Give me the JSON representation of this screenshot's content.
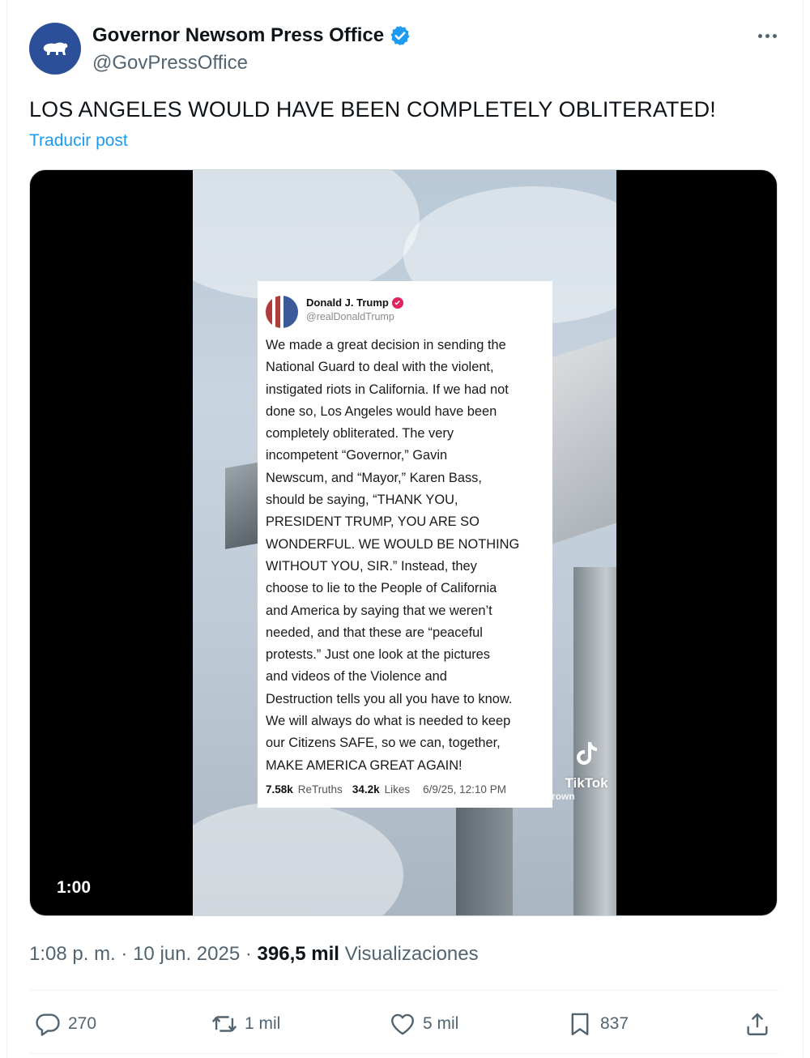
{
  "author": {
    "name": "Governor Newsom Press Office",
    "handle": "@GovPressOffice",
    "verified": true,
    "verified_color": "#1d9bf0",
    "avatar_color": "#2c4f9a"
  },
  "post": {
    "text": "LOS ANGELES WOULD HAVE BEEN COMPLETELY OBLITERATED!",
    "translate_label": "Traducir post"
  },
  "media": {
    "duration": "1:00",
    "embedded_post": {
      "name": "Donald J. Trump",
      "handle": "@realDonaldTrump",
      "body": "We made a great decision in sending the\nNational Guard to deal with the violent,\ninstigated riots in California. If we had not\ndone so, Los Angeles would have been\ncompletely obliterated. The very\nincompetent “Governor,”  Gavin\nNewscum, and “Mayor,” Karen Bass,\nshould be saying, “THANK YOU,\nPRESIDENT TRUMP, YOU ARE SO\nWONDERFUL. WE WOULD BE NOTHING\nWITHOUT YOU, SIR.” Instead, they\nchoose to lie to the People of California\nand America by saying that we weren’t\nneeded, and that these are “peaceful\nprotests.” Just one look at the pictures\nand videos of the Violence and\nDestruction tells you all you have to know.\nWe will always do what is needed to keep\nour Citizens SAFE, so we can, together,\nMAKE AMERICA GREAT AGAIN!",
      "retruths_count": "7.58k",
      "retruths_label": "ReTruths",
      "likes_count": "34.2k",
      "likes_label": "Likes",
      "date": "6/9/25, 12:10 PM"
    },
    "watermark": {
      "brand": "TikTok",
      "user": "@...thebrown"
    }
  },
  "meta": {
    "time": "1:08 p. m.",
    "separator": "·",
    "date": "10 jun. 2025",
    "views_count": "396,5 mil",
    "views_label": "Visualizaciones"
  },
  "actions": {
    "replies": "270",
    "reposts": "1 mil",
    "likes": "5 mil",
    "bookmarks": "837"
  },
  "icons": [
    "more-icon",
    "verified-icon",
    "reply-icon",
    "repost-icon",
    "like-icon",
    "bookmark-icon",
    "share-icon",
    "bear-icon"
  ]
}
